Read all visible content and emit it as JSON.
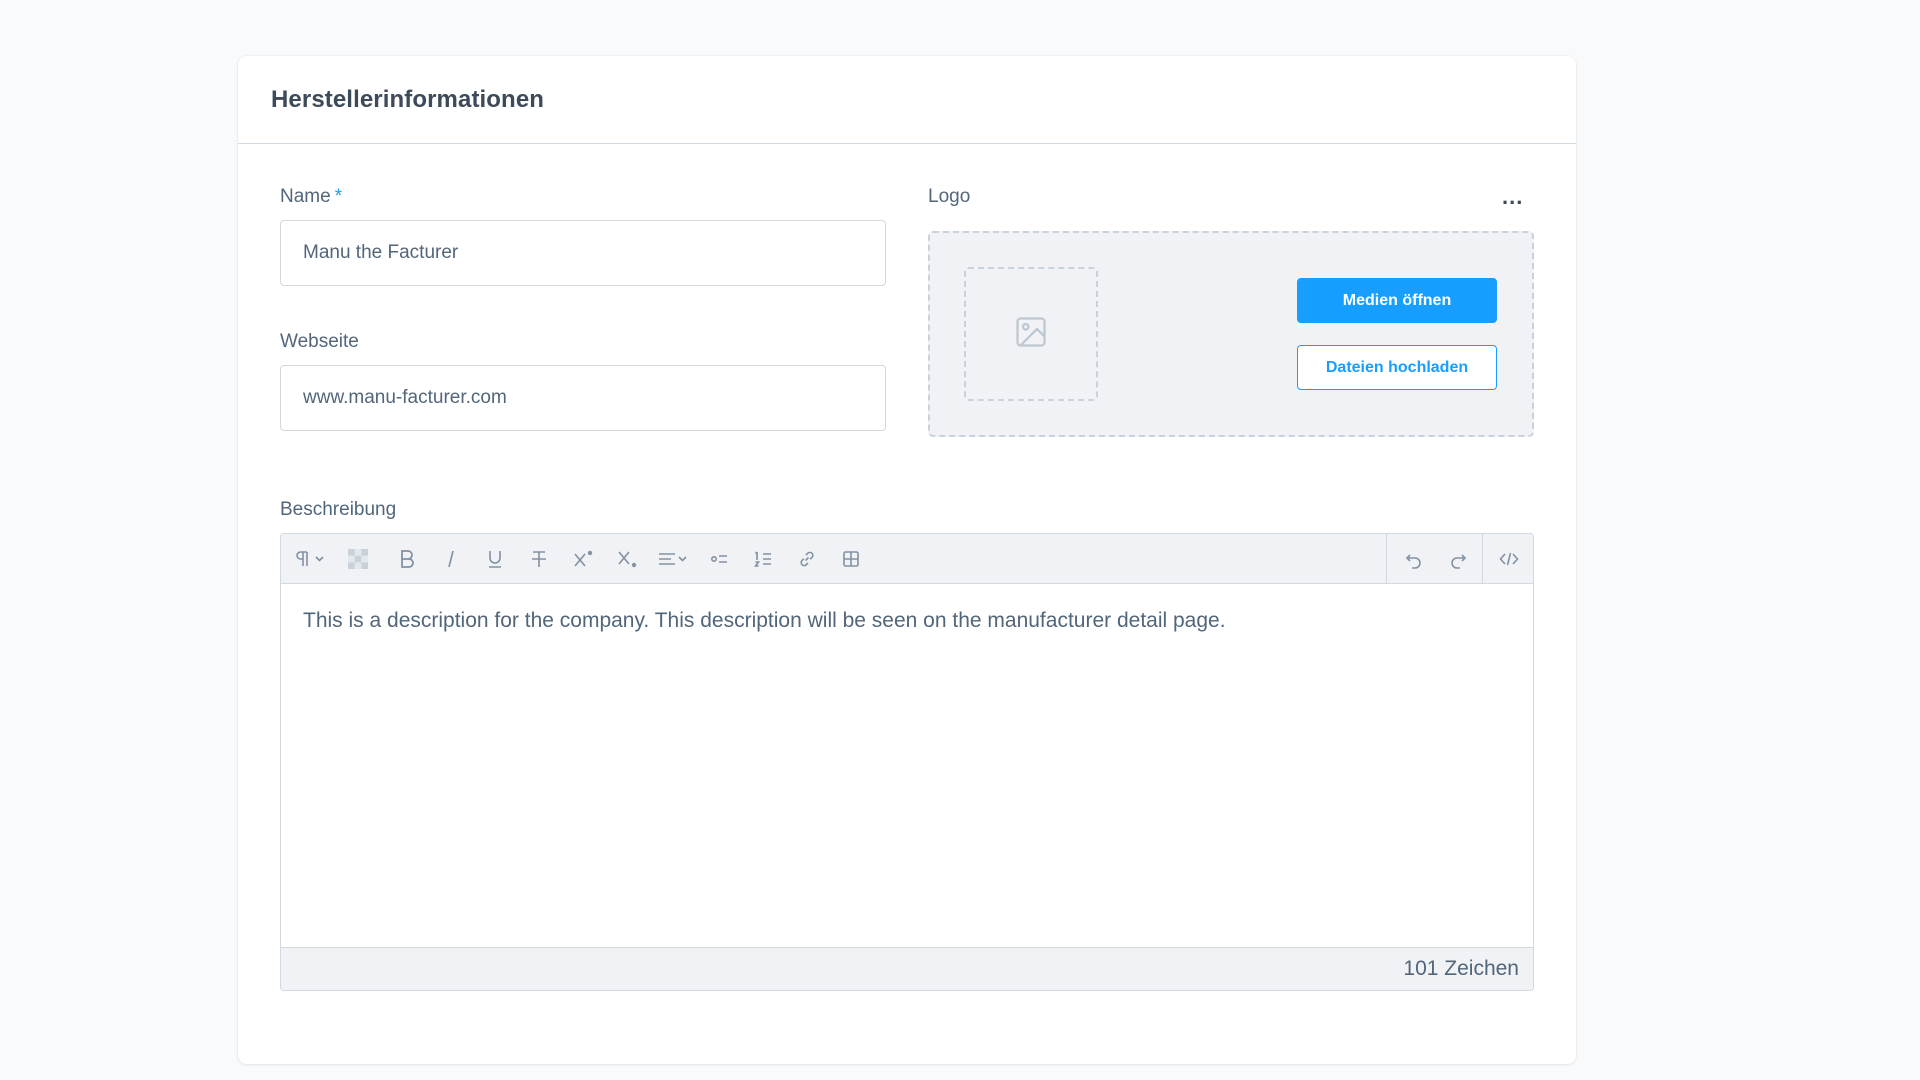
{
  "card": {
    "title": "Herstellerinformationen"
  },
  "name_field": {
    "label": "Name",
    "required_mark": "*",
    "value": "Manu the Facturer"
  },
  "website_field": {
    "label": "Webseite",
    "value": "www.manu-facturer.com"
  },
  "logo": {
    "label": "Logo",
    "menu_label": "...",
    "open_media_label": "Medien öffnen",
    "upload_files_label": "Dateien hochladen",
    "placeholder_icon": "image-icon"
  },
  "description": {
    "label": "Beschreibung",
    "content": "This is a description for the company. This description will be seen on the manufacturer detail page.",
    "char_count": "101 Zeichen",
    "toolbar_icons": [
      "paragraph-format-icon",
      "color-picker-icon",
      "bold-icon",
      "italic-icon",
      "underline-icon",
      "strikethrough-icon",
      "superscript-icon",
      "subscript-icon",
      "align-icon",
      "bullet-list-icon",
      "numbered-list-icon",
      "link-icon",
      "table-icon",
      "undo-icon",
      "redo-icon",
      "code-view-icon"
    ]
  },
  "colors": {
    "accent": "#189eff",
    "text": "#52667a",
    "border": "#d1d9e0",
    "toolbar_bg": "#f0f2f5"
  }
}
